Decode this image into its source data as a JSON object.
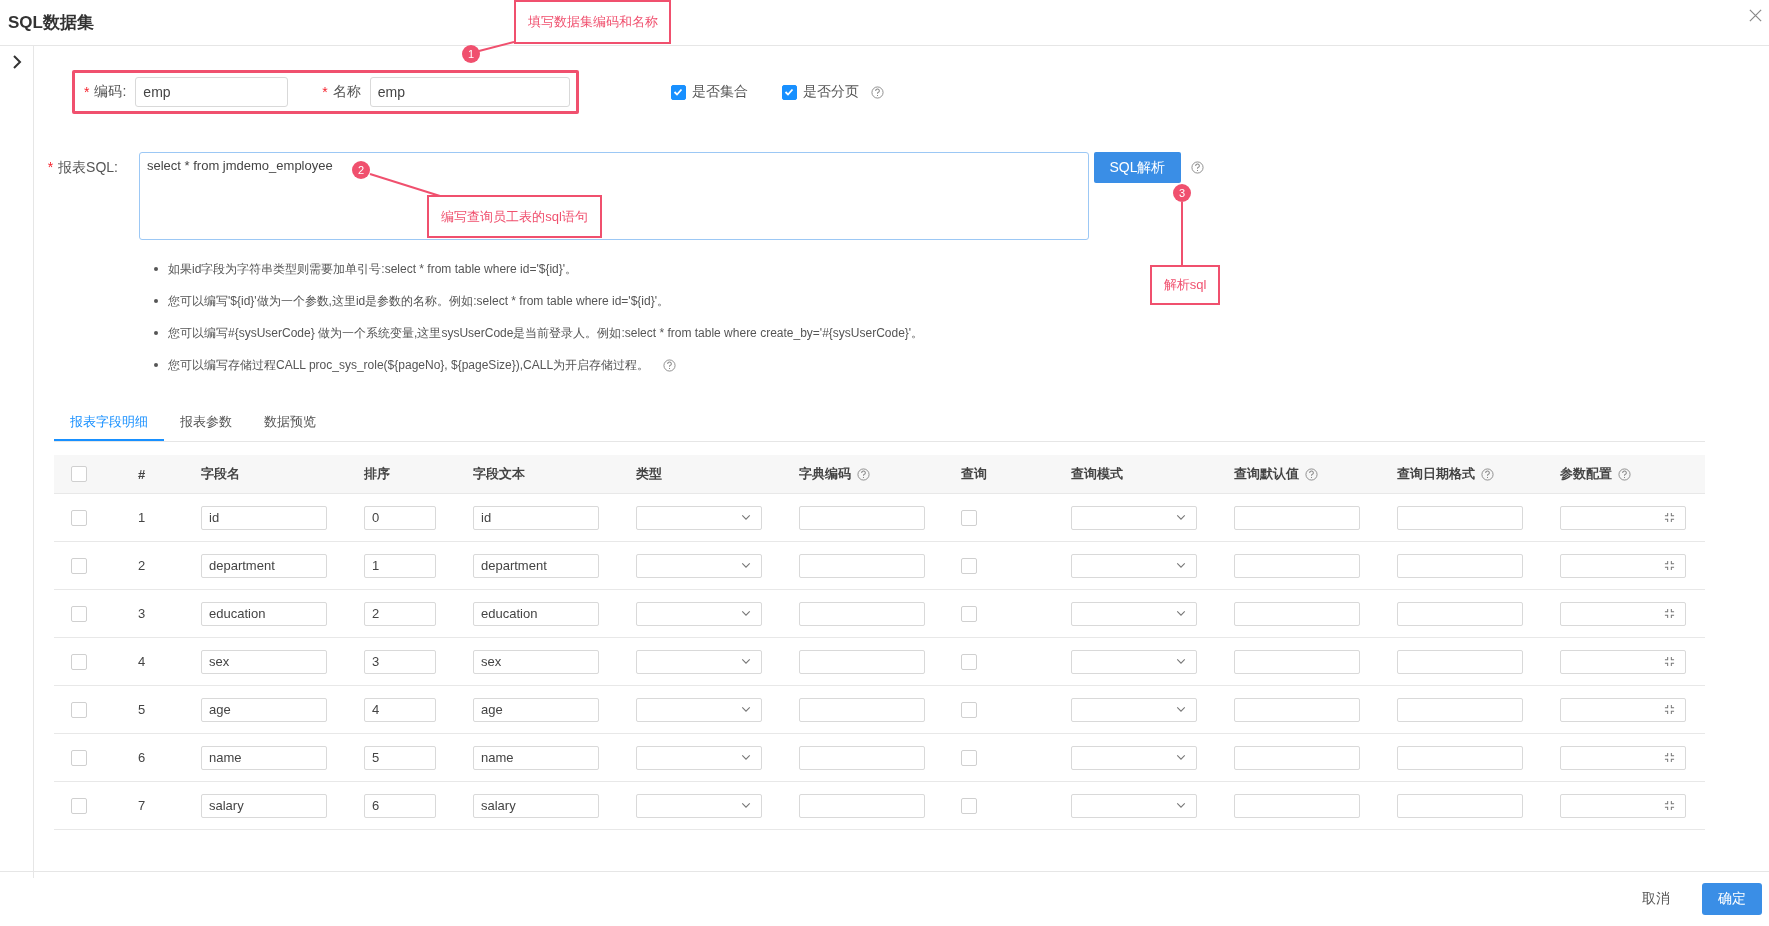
{
  "dialog": {
    "title": "SQL数据集"
  },
  "form": {
    "code": {
      "mark": "*",
      "label": "编码:",
      "value": "emp"
    },
    "name": {
      "mark": "*",
      "label": "名称",
      "value": "emp"
    },
    "options": [
      {
        "label": "是否集合",
        "checked": true,
        "help": false
      },
      {
        "label": "是否分页",
        "checked": true,
        "help": true
      }
    ],
    "sql": {
      "mark": "*",
      "label": "报表SQL:",
      "value": "select * from jmdemo_employee"
    },
    "parse_button": "SQL解析"
  },
  "hints": [
    {
      "text": "如果id字段为字符串类型则需要加单引号:select * from table where id='${id}'。",
      "help": false
    },
    {
      "text": "您可以编写'${id}'做为一个参数,这里id是参数的名称。例如:select * from table where id='${id}'。",
      "help": false
    },
    {
      "text": "您可以编写#{sysUserCode} 做为一个系统变量,这里sysUserCode是当前登录人。例如:select * from table where create_by='#{sysUserCode}'。",
      "help": false
    },
    {
      "text": "您可以编写存储过程CALL proc_sys_role(${pageNo}, ${pageSize}),CALL为开启存储过程。",
      "help": true
    }
  ],
  "tabs": [
    {
      "label": "报表字段明细",
      "selected": true
    },
    {
      "label": "报表参数",
      "selected": false
    },
    {
      "label": "数据预览",
      "selected": false
    }
  ],
  "table": {
    "all_selected": false,
    "columns": [
      {
        "label": "#",
        "help": false
      },
      {
        "label": "字段名",
        "help": false
      },
      {
        "label": "排序",
        "help": false
      },
      {
        "label": "字段文本",
        "help": false
      },
      {
        "label": "类型",
        "help": false
      },
      {
        "label": "字典编码",
        "help": true
      },
      {
        "label": "查询",
        "help": false
      },
      {
        "label": "查询模式",
        "help": false
      },
      {
        "label": "查询默认值",
        "help": true
      },
      {
        "label": "查询日期格式",
        "help": true
      },
      {
        "label": "参数配置",
        "help": true
      }
    ],
    "rows": [
      {
        "selected": false,
        "index": "1",
        "field_name": "id",
        "order": "0",
        "field_text": "id",
        "query": false
      },
      {
        "selected": false,
        "index": "2",
        "field_name": "department",
        "order": "1",
        "field_text": "department",
        "query": false
      },
      {
        "selected": false,
        "index": "3",
        "field_name": "education",
        "order": "2",
        "field_text": "education",
        "query": false
      },
      {
        "selected": false,
        "index": "4",
        "field_name": "sex",
        "order": "3",
        "field_text": "sex",
        "query": false
      },
      {
        "selected": false,
        "index": "5",
        "field_name": "age",
        "order": "4",
        "field_text": "age",
        "query": false
      },
      {
        "selected": false,
        "index": "6",
        "field_name": "name",
        "order": "5",
        "field_text": "name",
        "query": false
      },
      {
        "selected": false,
        "index": "7",
        "field_name": "salary",
        "order": "6",
        "field_text": "salary",
        "query": false
      }
    ]
  },
  "footer": {
    "cancel": "取消",
    "confirm": "确定"
  },
  "annotations": [
    {
      "number": "1",
      "text": "填写数据集编码和名称"
    },
    {
      "number": "2",
      "text": "编写查询员工表的sql语句"
    },
    {
      "number": "3",
      "text": "解析sql"
    }
  ]
}
